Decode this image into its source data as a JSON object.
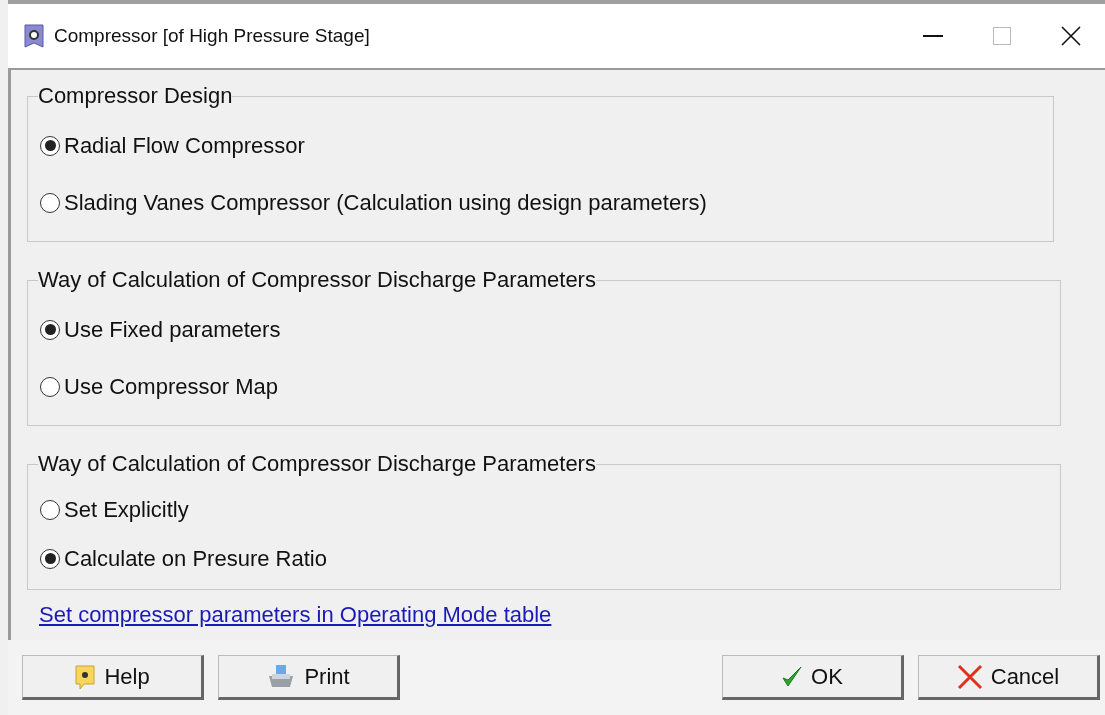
{
  "window": {
    "title": "Compressor [of High Pressure Stage]"
  },
  "groups": [
    {
      "title": "Compressor Design",
      "options": [
        {
          "label": "Radial Flow Compressor",
          "selected": true
        },
        {
          "label": "Slading Vanes Compressor (Calculation using design parameters)",
          "selected": false
        }
      ]
    },
    {
      "title": "Way of Calculation of Compressor Discharge Parameters",
      "options": [
        {
          "label": "Use Fixed parameters",
          "selected": true
        },
        {
          "label": "Use Compressor Map",
          "selected": false
        }
      ]
    },
    {
      "title": "Way of Calculation of Compressor Discharge Parameters",
      "options": [
        {
          "label": "Set Explicitly",
          "selected": false
        },
        {
          "label": "Calculate on Presure Ratio",
          "selected": true
        }
      ]
    }
  ],
  "link": "Set compressor parameters in Operating Mode table",
  "buttons": [
    {
      "label": "Help",
      "kind": "help"
    },
    {
      "label": "Print",
      "kind": "print"
    },
    {
      "label": "OK",
      "kind": "ok"
    },
    {
      "label": "Cancel",
      "kind": "cancel"
    }
  ]
}
